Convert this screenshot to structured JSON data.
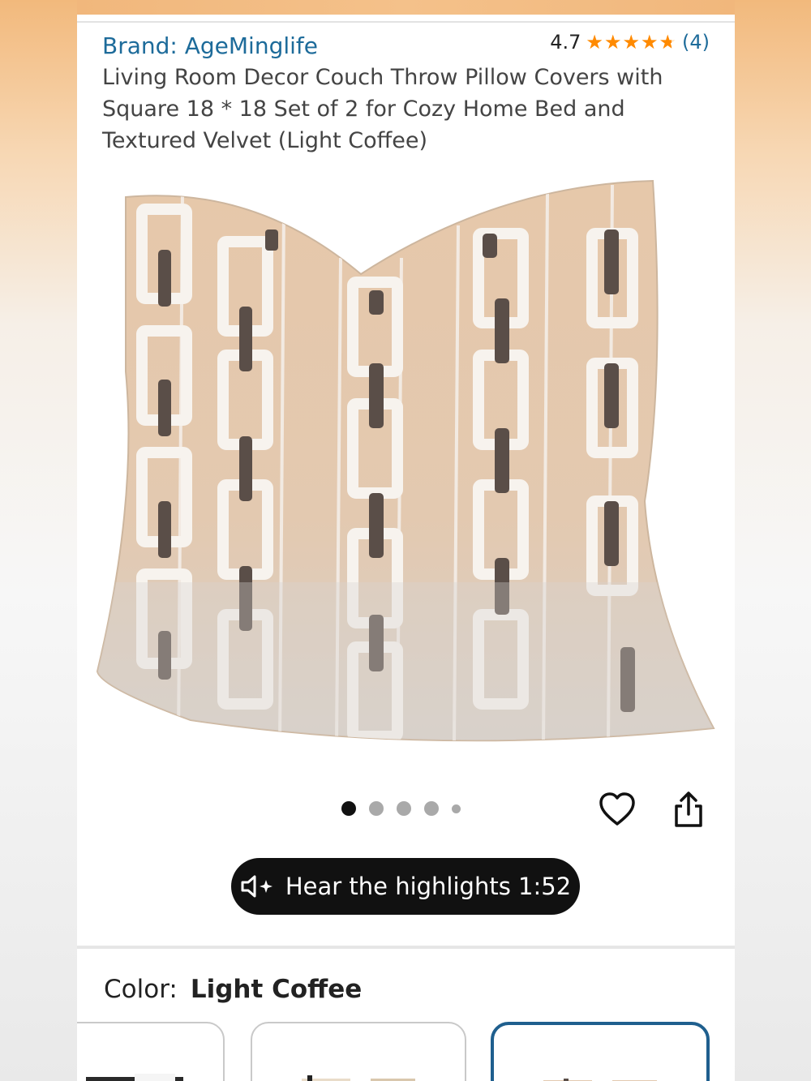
{
  "product": {
    "brand_label": "Brand: AgeMinglife",
    "rating_value": "4.7",
    "rating_fraction": 0.94,
    "rating_count": "(4)",
    "title": "Living Room Decor Couch Throw Pillow Covers with Square 18 * 18 Set of 2 for Cozy Home Bed and Textured Velvet (Light Coffee)"
  },
  "gallery": {
    "image_count": 5,
    "active_index": 0
  },
  "audio": {
    "label": "Hear the highlights 1:52"
  },
  "color": {
    "label": "Color:",
    "value": "Light Coffee"
  },
  "colors": {
    "accent_link": "#1d6b9a",
    "star": "#ff8a00",
    "selected_border": "#1f5f8e"
  }
}
